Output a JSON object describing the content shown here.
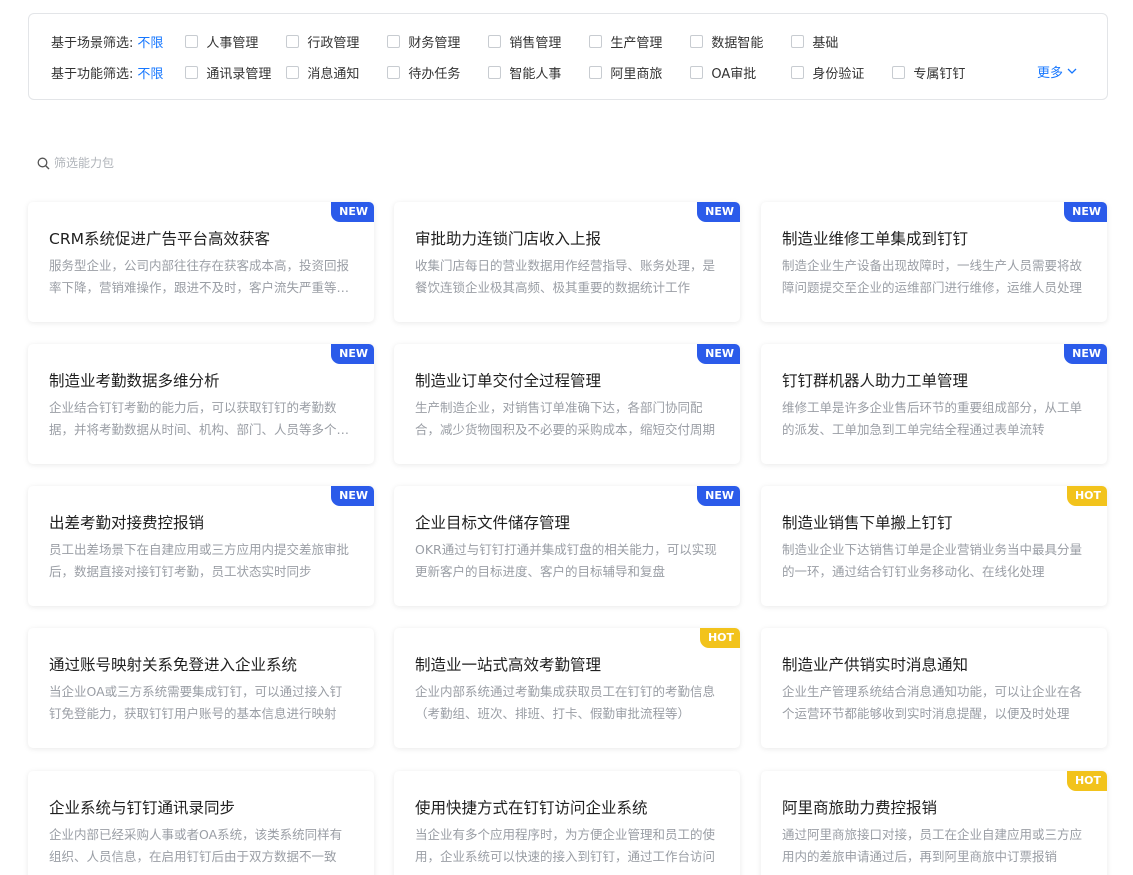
{
  "filters": {
    "scene": {
      "label": "基于场景筛选:",
      "unlimited": "不限",
      "options": [
        "人事管理",
        "行政管理",
        "财务管理",
        "销售管理",
        "生产管理",
        "数据智能",
        "基础"
      ]
    },
    "function": {
      "label": "基于功能筛选:",
      "unlimited": "不限",
      "options": [
        "通讯录管理",
        "消息通知",
        "待办任务",
        "智能人事",
        "阿里商旅",
        "OA审批",
        "身份验证",
        "专属钉钉"
      ]
    },
    "more_label": "更多"
  },
  "search": {
    "placeholder": "筛选能力包"
  },
  "colors": {
    "accent": "#1677ff",
    "new_badge": "#2b5bea",
    "hot_badge": "#f2c31c"
  },
  "cards": [
    {
      "title": "CRM系统促进广告平台高效获客",
      "desc": "服务型企业，公司内部往往存在获客成本高，投资回报率下降，营销难操作，跟进不及时，客户流失严重等问题",
      "badge": "NEW",
      "badge_type": "new"
    },
    {
      "title": "审批助力连锁门店收入上报",
      "desc": "收集门店每日的营业数据用作经营指导、账务处理，是餐饮连锁企业极其高频、极其重要的数据统计工作",
      "badge": "NEW",
      "badge_type": "new"
    },
    {
      "title": "制造业维修工单集成到钉钉",
      "desc": "制造企业生产设备出现故障时，一线生产人员需要将故障问题提交至企业的运维部门进行维修，运维人员处理",
      "badge": "NEW",
      "badge_type": "new"
    },
    {
      "title": "制造业考勤数据多维分析",
      "desc": "企业结合钉钉考勤的能力后，可以获取钉钉的考勤数据，并将考勤数据从时间、机构、部门、人员等多个维度分析",
      "badge": "NEW",
      "badge_type": "new"
    },
    {
      "title": "制造业订单交付全过程管理",
      "desc": "生产制造企业，对销售订单准确下达，各部门协同配合，减少货物囤积及不必要的采购成本，缩短交付周期",
      "badge": "NEW",
      "badge_type": "new"
    },
    {
      "title": "钉钉群机器人助力工单管理",
      "desc": "维修工单是许多企业售后环节的重要组成部分，从工单的派发、工单加急到工单完结全程通过表单流转",
      "badge": "NEW",
      "badge_type": "new"
    },
    {
      "title": "出差考勤对接费控报销",
      "desc": "员工出差场景下在自建应用或三方应用内提交差旅审批后，数据直接对接钉钉考勤，员工状态实时同步",
      "badge": "NEW",
      "badge_type": "new"
    },
    {
      "title": "企业目标文件储存管理",
      "desc": "OKR通过与钉钉打通并集成钉盘的相关能力，可以实现更新客户的目标进度、客户的目标辅导和复盘",
      "badge": "NEW",
      "badge_type": "new"
    },
    {
      "title": "制造业销售下单搬上钉钉",
      "desc": "制造业企业下达销售订单是企业营销业务当中最具分量的一环，通过结合钉钉业务移动化、在线化处理",
      "badge": "HOT",
      "badge_type": "hot"
    },
    {
      "title": "通过账号映射关系免登进入企业系统",
      "desc": "当企业OA或三方系统需要集成钉钉，可以通过接入钉钉免登能力，获取钉钉用户账号的基本信息进行映射",
      "badge": "",
      "badge_type": ""
    },
    {
      "title": "制造业一站式高效考勤管理",
      "desc": "企业内部系统通过考勤集成获取员工在钉钉的考勤信息（考勤组、班次、排班、打卡、假勤审批流程等）",
      "badge": "HOT",
      "badge_type": "hot"
    },
    {
      "title": "制造业产供销实时消息通知",
      "desc": "企业生产管理系统结合消息通知功能，可以让企业在各个运营环节都能够收到实时消息提醒，以便及时处理",
      "badge": "",
      "badge_type": ""
    },
    {
      "title": "企业系统与钉钉通讯录同步",
      "desc": "企业内部已经采购人事或者OA系统，该类系统同样有组织、人员信息，在启用钉钉后由于双方数据不一致",
      "badge": "",
      "badge_type": ""
    },
    {
      "title": "使用快捷方式在钉钉访问企业系统",
      "desc": "当企业有多个应用程序时，为方便企业管理和员工的使用，企业系统可以快速的接入到钉钉，通过工作台访问",
      "badge": "",
      "badge_type": ""
    },
    {
      "title": "阿里商旅助力费控报销",
      "desc": "通过阿里商旅接口对接，员工在企业自建应用或三方应用内的差旅申请通过后，再到阿里商旅中订票报销",
      "badge": "HOT",
      "badge_type": "hot"
    }
  ]
}
